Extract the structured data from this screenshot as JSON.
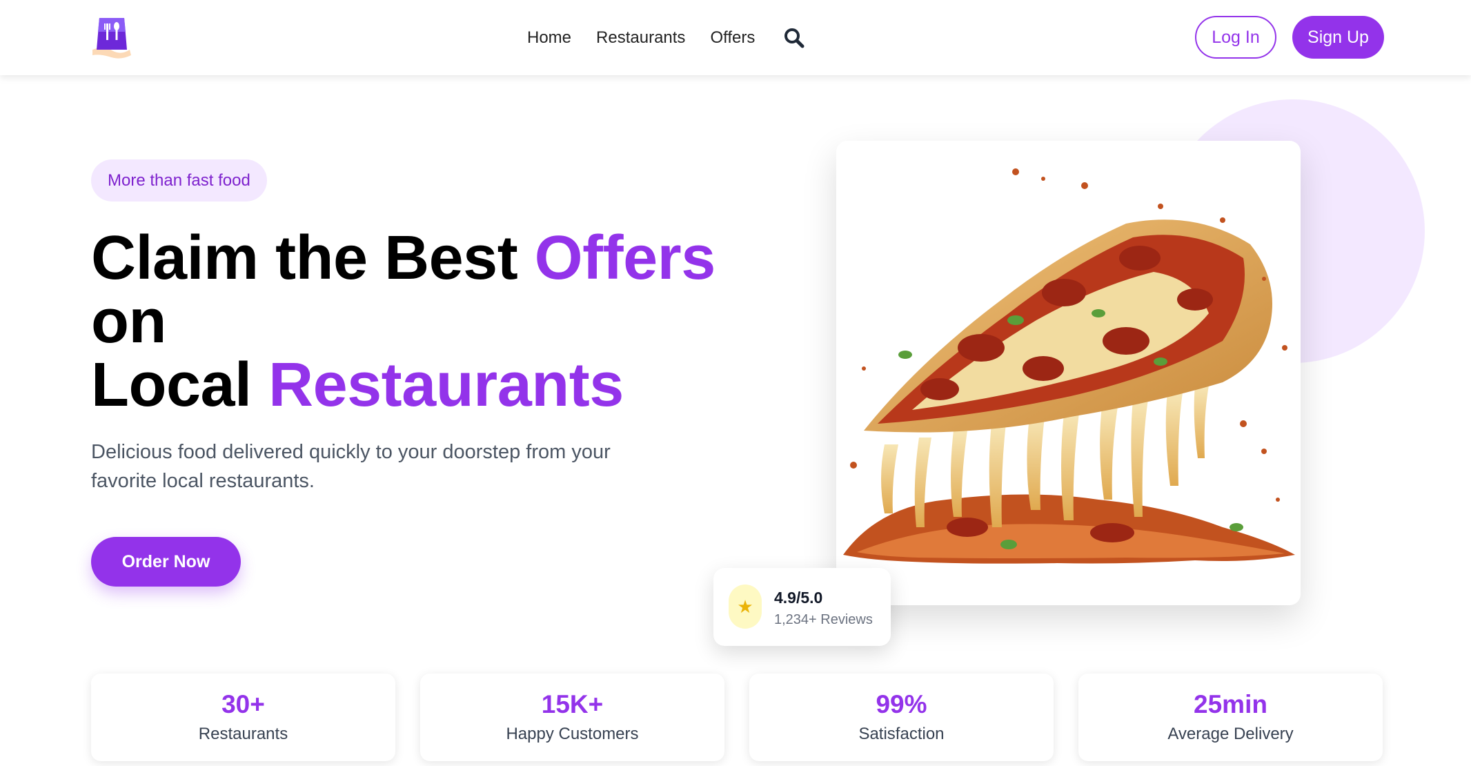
{
  "nav": {
    "links": [
      "Home",
      "Restaurants",
      "Offers"
    ],
    "login_label": "Log In",
    "signup_label": "Sign Up"
  },
  "hero": {
    "tagline": "More than fast food",
    "headline": {
      "part1": "Claim the Best ",
      "accent1": "Offers",
      "part2": "on",
      "part3": "Local ",
      "accent2": "Restaurants"
    },
    "description": "Delicious food delivered quickly to your doorstep from your favorite local restaurants.",
    "cta_label": "Order Now"
  },
  "rating": {
    "icon": "star-icon",
    "value": "4.9/5.0",
    "reviews": "1,234+ Reviews"
  },
  "stats": [
    {
      "value": "30+",
      "label": "Restaurants"
    },
    {
      "value": "15K+",
      "label": "Happy Customers"
    },
    {
      "value": "99%",
      "label": "Satisfaction"
    },
    {
      "value": "25min",
      "label": "Average Delivery"
    }
  ],
  "colors": {
    "accent": "#9333ea",
    "accent_light": "#f3e8ff",
    "text_dark": "#111827",
    "text_muted": "#4b5563"
  }
}
